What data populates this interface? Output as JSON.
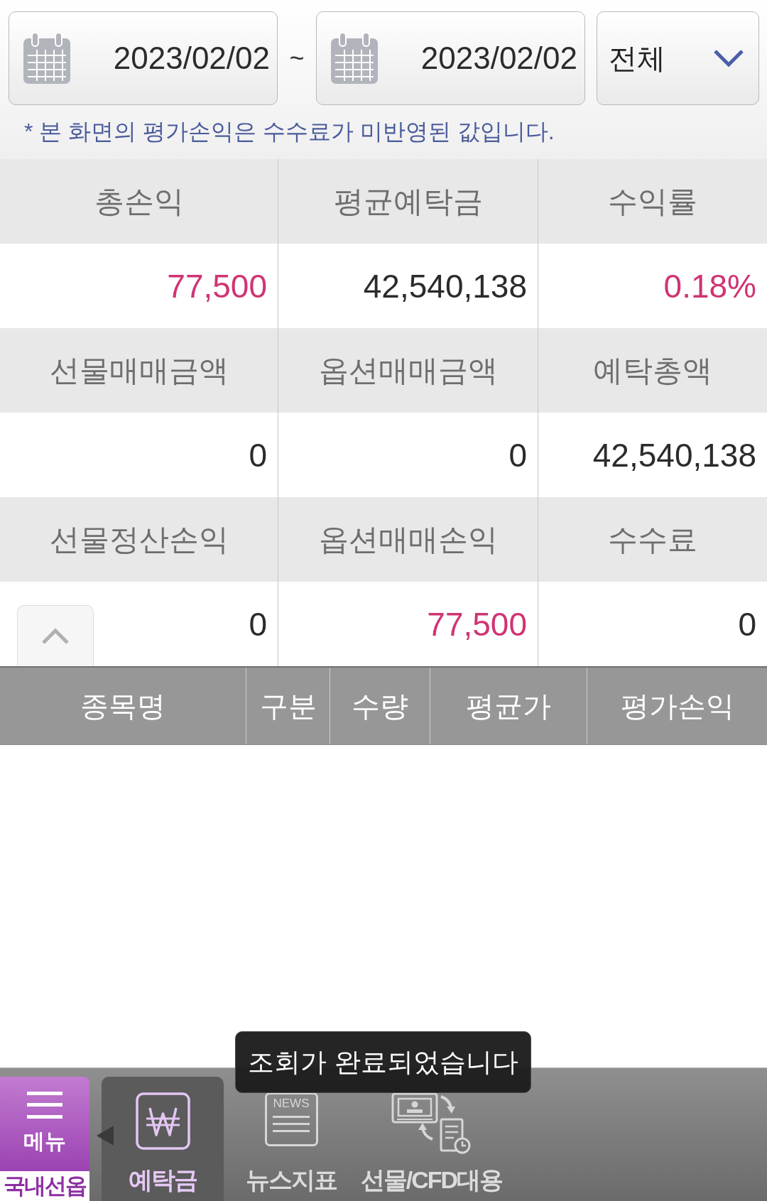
{
  "date_range": {
    "start": "2023/02/02",
    "separator": "~",
    "end": "2023/02/02"
  },
  "filter_dropdown": {
    "value": "전체"
  },
  "notice": "* 본 화면의 평가손익은 수수료가 미반영된 값입니다.",
  "summary": {
    "expanded": true,
    "rows": [
      {
        "cells": [
          {
            "label": "총손익",
            "value": "77,500",
            "color": "#cf3473"
          },
          {
            "label": "평균예탁금",
            "value": "42,540,138",
            "color": "#2b2b2b"
          },
          {
            "label": "수익률",
            "value": "0.18%",
            "color": "#cf3473"
          }
        ]
      },
      {
        "cells": [
          {
            "label": "선물매매금액",
            "value": "0",
            "color": "#2b2b2b"
          },
          {
            "label": "옵션매매금액",
            "value": "0",
            "color": "#2b2b2b"
          },
          {
            "label": "예탁총액",
            "value": "42,540,138",
            "color": "#2b2b2b"
          }
        ]
      },
      {
        "cells": [
          {
            "label": "선물정산손익",
            "value": "0",
            "color": "#2b2b2b"
          },
          {
            "label": "옵션매매손익",
            "value": "77,500",
            "color": "#cf3473"
          },
          {
            "label": "수수료",
            "value": "0",
            "color": "#2b2b2b"
          }
        ]
      }
    ]
  },
  "positions_table": {
    "columns": [
      "종목명",
      "구분",
      "수량",
      "평균가",
      "평가손익"
    ]
  },
  "toast": "조회가 완료되었습니다",
  "bottom_nav": {
    "menu_button": {
      "label": "메뉴"
    },
    "section_label": "국내선옵",
    "tabs": [
      {
        "kind": "won",
        "label": "예탁금",
        "selected": true
      },
      {
        "kind": "news",
        "label": "뉴스지표",
        "icon_text": "NEWS",
        "selected": false
      },
      {
        "kind": "exchange",
        "label": "선물/CFD대용",
        "selected": false
      }
    ]
  }
}
